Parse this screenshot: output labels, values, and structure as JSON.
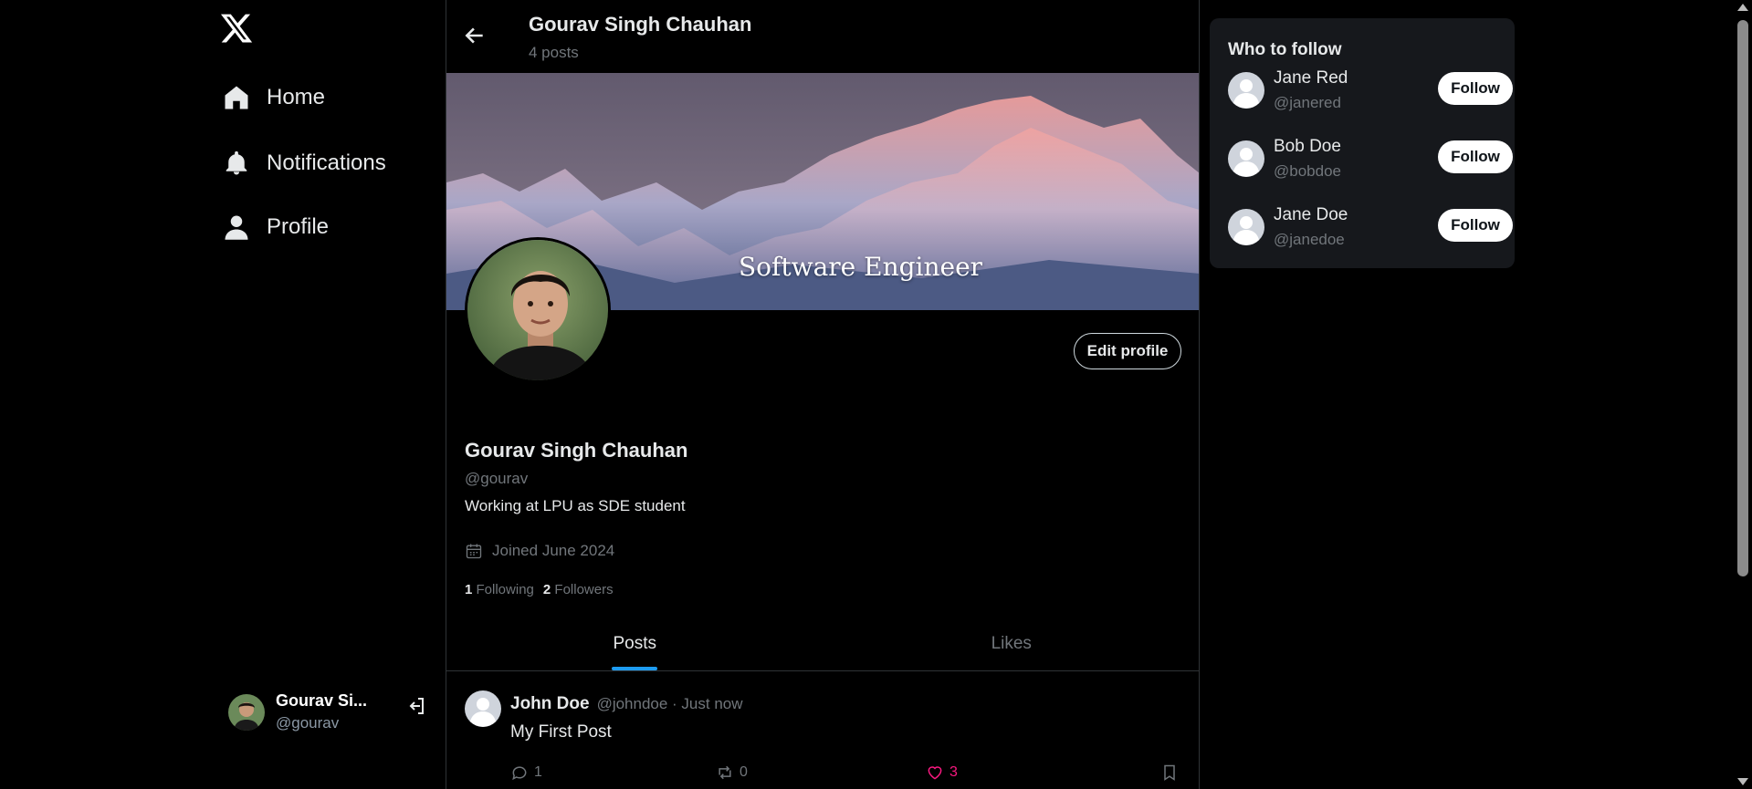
{
  "nav": {
    "home": "Home",
    "notifications": "Notifications",
    "profile": "Profile"
  },
  "account": {
    "name": "Gourav Si...",
    "handle": "@gourav"
  },
  "header": {
    "title": "Gourav Singh Chauhan",
    "post_count": "4 posts"
  },
  "banner": {
    "text": "Software Engineer"
  },
  "profile": {
    "edit_label": "Edit profile",
    "name": "Gourav Singh Chauhan",
    "handle": "@gourav",
    "bio": "Working at LPU as SDE student",
    "joined": "Joined June 2024",
    "following_count": "1",
    "following_label": "Following",
    "followers_count": "2",
    "followers_label": "Followers"
  },
  "tabs": [
    {
      "label": "Posts",
      "active": true
    },
    {
      "label": "Likes",
      "active": false
    }
  ],
  "post": {
    "author": "John Doe",
    "meta": "@johndoe · Just now",
    "text": "My First Post",
    "replies": "1",
    "reposts": "0",
    "likes": "3"
  },
  "who_to_follow": {
    "title": "Who to follow",
    "users": [
      {
        "name": "Jane Red",
        "handle": "@janered",
        "button": "Follow"
      },
      {
        "name": "Bob Doe",
        "handle": "@bobdoe",
        "button": "Follow"
      },
      {
        "name": "Jane Doe",
        "handle": "@janedoe",
        "button": "Follow"
      }
    ]
  },
  "colors": {
    "accent": "#1d9bf0",
    "like": "#f91880",
    "panel": "#16181c",
    "muted": "#71767b"
  }
}
